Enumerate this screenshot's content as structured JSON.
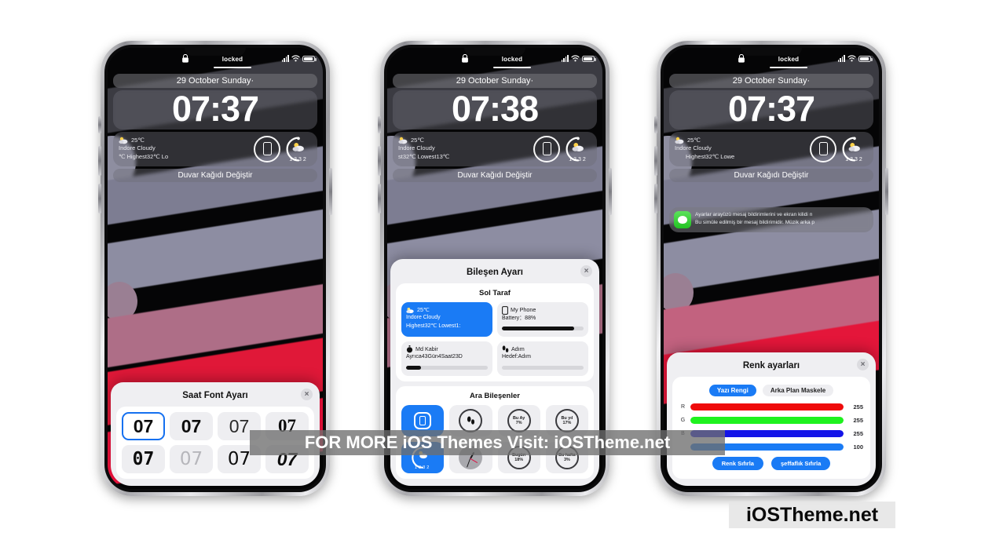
{
  "watermarks": {
    "banner": "FOR MORE iOS Themes Visit: iOSTheme.net",
    "logo": "iOSTheme.net"
  },
  "status_bar": {
    "lock_icon": "lock-icon",
    "locked_label": "locked",
    "signal_icon": "signal-bars-icon",
    "wifi_icon": "wifi-icon",
    "battery_icon": "battery-icon"
  },
  "lock_screen": {
    "date": "29 October Sunday·",
    "weather_temp": "25℃",
    "weather_place": "Indore  Cloudy",
    "right_widget_left_label": "13",
    "right_widget_right_label": "32",
    "change_wallpaper": "Duvar Kağıdı Değiştir"
  },
  "phones": [
    {
      "id": "phone-left",
      "clock": "07:37",
      "weather_range": "℃      Highest32℃  Lo",
      "panel": {
        "title": "Saat Font Ayarı",
        "close_label": "×",
        "fonts": [
          {
            "sample": "07",
            "style": "bold-sel",
            "selected": true
          },
          {
            "sample": "07",
            "style": "bold",
            "selected": false
          },
          {
            "sample": "07",
            "style": "light",
            "selected": false
          },
          {
            "sample": "07",
            "style": "serif",
            "selected": false
          },
          {
            "sample": "07",
            "style": "mono",
            "selected": false
          },
          {
            "sample": "07",
            "style": "thin",
            "selected": false
          },
          {
            "sample": "07",
            "style": "round",
            "selected": false
          },
          {
            "sample": "07",
            "style": "heavy",
            "selected": false
          }
        ]
      }
    },
    {
      "id": "phone-center",
      "clock": "07:38",
      "weather_range": "st32℃  Lowest13℃",
      "panel": {
        "title": "Bileşen Ayarı",
        "close_label": "×",
        "section_left_title": "Sol Taraf",
        "left_components": [
          {
            "icon": "weather-cloud-sun-icon",
            "line1": "25℃",
            "line2": "Indore  Cloudy",
            "line3": "Highest32℃  Lowest1:",
            "active": true,
            "progress": null
          },
          {
            "icon": "phone-battery-icon",
            "line1": "My Phone",
            "line2": "Battery：88%",
            "line3": "",
            "active": false,
            "progress": 88
          },
          {
            "icon": "stopwatch-icon",
            "line1": "Md Kabir",
            "line2": "Ayrıca43Gün4Saat23D",
            "line3": "",
            "active": false,
            "progress": 18
          },
          {
            "icon": "footsteps-icon",
            "line1": "Adım",
            "line2": "Hedef:Adım",
            "line3": "",
            "active": false,
            "progress": 0
          }
        ],
        "section_mid_title": "Ara Bileşenler",
        "mid_components_row1": [
          {
            "icon": "phone-square-icon",
            "top": "",
            "bottom": "",
            "active": true
          },
          {
            "icon": "footsteps-ring-icon",
            "top": "",
            "bottom": "",
            "active": false
          },
          {
            "icon": "ring-progress-icon",
            "top": "Bu Ay",
            "bottom": "7%",
            "active": false
          },
          {
            "icon": "ring-progress-icon",
            "top": "Bu yıl",
            "bottom": "17%",
            "active": false
          }
        ],
        "mid_components_row2": [
          {
            "icon": "weather-ring-icon",
            "top": "13",
            "bottom": "32",
            "active": true
          },
          {
            "icon": "analog-clock-icon",
            "top": "",
            "bottom": "",
            "active": false
          },
          {
            "icon": "ring-progress-icon",
            "top": "Bugün",
            "bottom": "18%",
            "active": false
          },
          {
            "icon": "ring-progress-icon",
            "top": "Bu hafta",
            "bottom": "3%",
            "active": false
          }
        ]
      }
    },
    {
      "id": "phone-right",
      "clock": "07:37",
      "weather_range": "Highest32℃  Lowe",
      "notification": {
        "icon": "messages-app-icon",
        "line1": "Ayarlar arayüzü mesaj bildirimlerini ve ekran kilidi n",
        "line2": "Bu simüle edilmiş bir mesaj bildirimidir.  Müzik arka p"
      },
      "panel": {
        "title": "Renk ayarları",
        "close_label": "×",
        "tabs": [
          {
            "label": "Yazı Rengi",
            "active": true
          },
          {
            "label": "Arka Plan Maskele",
            "active": false
          }
        ],
        "sliders": [
          {
            "label": "R",
            "value": "255",
            "fill": 100,
            "color": "#ef0b0b"
          },
          {
            "label": "G",
            "value": "255",
            "fill": 100,
            "color": "#1ef21e"
          },
          {
            "label": "B",
            "value": "255",
            "fill": 100,
            "color": "#1313e8"
          },
          {
            "label": "",
            "value": "100",
            "fill": 100,
            "color": "#1a7bf5"
          }
        ],
        "buttons": [
          {
            "label": "Renk Sıfırla"
          },
          {
            "label": "şeffaflık Sıfırla"
          }
        ]
      }
    }
  ],
  "colors": {
    "accent": "#1a7bf5",
    "sheet_bg": "#efeff2",
    "screen_bg": "#050506",
    "page_bg": "#ffffff"
  }
}
